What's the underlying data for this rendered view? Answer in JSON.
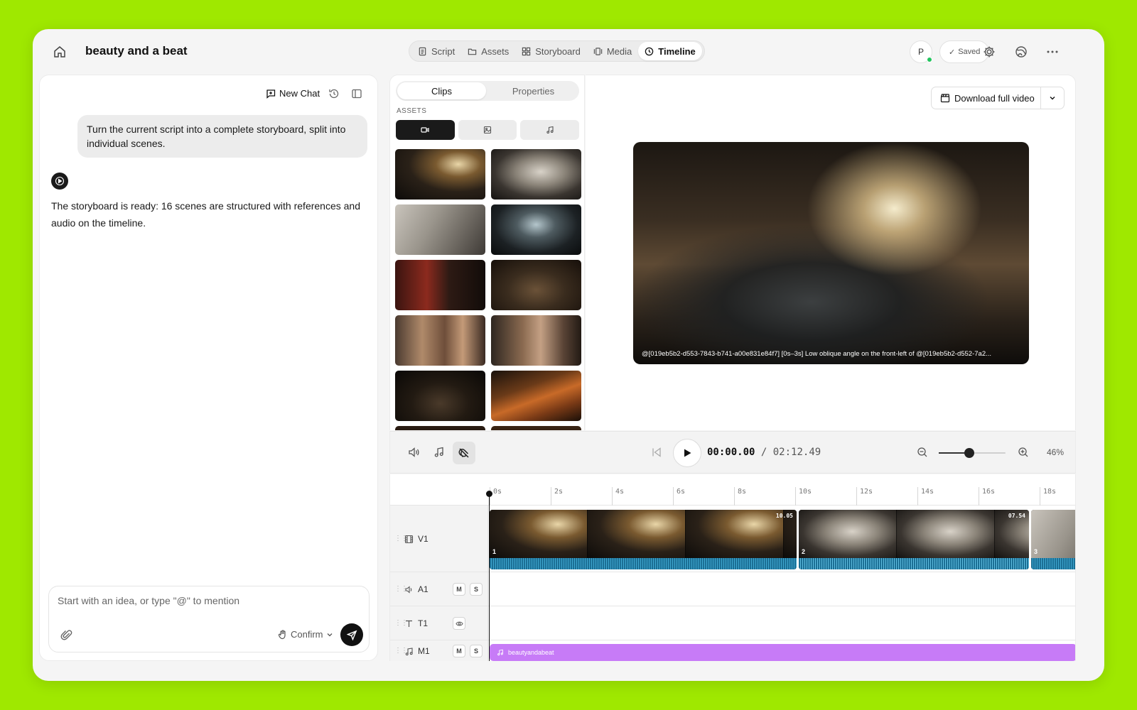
{
  "header": {
    "title": "beauty and a beat",
    "tabs": [
      {
        "label": "Script",
        "icon": "script-icon"
      },
      {
        "label": "Assets",
        "icon": "folder-icon"
      },
      {
        "label": "Storyboard",
        "icon": "grid-icon"
      },
      {
        "label": "Media",
        "icon": "media-icon"
      },
      {
        "label": "Timeline",
        "icon": "clock-icon",
        "active": true
      }
    ],
    "avatar_initial": "P",
    "saved_label": "Saved",
    "saved_check": "✓"
  },
  "chat": {
    "new_chat_label": "New Chat",
    "user_message": "Turn the current script into a complete storyboard, split into individual scenes.",
    "assistant_message": "The storyboard is ready: 16 scenes are structured with references and audio on the timeline.",
    "input_placeholder": "Start with an idea, or type \"@\" to mention",
    "confirm_label": "Confirm"
  },
  "assets": {
    "tabs": [
      {
        "label": "Clips",
        "active": true
      },
      {
        "label": "Properties",
        "active": false
      }
    ],
    "section_label": "ASSETS"
  },
  "preview": {
    "download_label": "Download full video",
    "caption": "@[019eb5b2-d553-7843-b741-a00e831e84f7] [0s–3s] Low oblique angle on the front-left of @[019eb5b2-d552-7a2..."
  },
  "transport": {
    "current_time": "00:00.00",
    "separator": "/",
    "total_time": "02:12.49",
    "zoom_percent": "46%",
    "zoom_level": 0.46
  },
  "timeline": {
    "ruler": [
      "0s",
      "2s",
      "4s",
      "6s",
      "8s",
      "10s",
      "12s",
      "14s",
      "16s",
      "18s"
    ],
    "tracks": [
      {
        "name": "V1",
        "icon": "film-icon"
      },
      {
        "name": "A1",
        "icon": "speaker-icon",
        "mute": "M",
        "solo": "S"
      },
      {
        "name": "T1",
        "icon": "text-icon"
      },
      {
        "name": "M1",
        "icon": "music-note-icon",
        "mute": "M",
        "solo": "S"
      }
    ],
    "clips": [
      {
        "number": "1",
        "duration": "10.05"
      },
      {
        "number": "2",
        "duration": "07.54"
      },
      {
        "number": "3",
        "duration": ""
      }
    ],
    "music_clip_name": "beautyandabeat"
  },
  "colors": {
    "accent_green": "#9fe800",
    "waveform": "#1b6f95",
    "music_clip": "#c77bf7"
  }
}
